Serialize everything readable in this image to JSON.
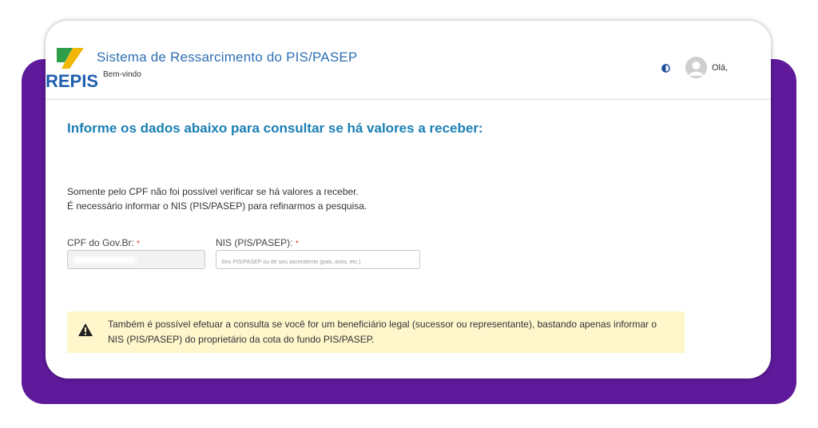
{
  "header": {
    "logo_text": "REPIS",
    "title": "Sistema de Ressarcimento do PIS/PASEP",
    "welcome": "Bem-vindo",
    "contrast_icon": "contrast-icon",
    "avatar_icon": "user-avatar-icon",
    "greeting": "Olá,"
  },
  "main": {
    "heading": "Informe os dados abaixo para consultar se há valores a receber:",
    "message_line1": "Somente pelo CPF não foi possível verificar se há valores a receber.",
    "message_line2": "É necessário informar o NIS (PIS/PASEP) para refinarmos a pesquisa.",
    "cpf": {
      "label": "CPF do Gov.Br:",
      "required_mark": "*",
      "value": ""
    },
    "nis": {
      "label": "NIS (PIS/PASEP):",
      "required_mark": "*",
      "placeholder": "Seu PIS/PASEP ou de seu ascendente (pais, avós, etc.)"
    },
    "alert": {
      "icon": "warning-icon",
      "text": "Também é possível efetuar a consulta se você for um beneficiário legal (sucessor ou representante), bastando apenas informar o NIS (PIS/PASEP) do proprietário da cota do fundo PIS/PASEP."
    }
  },
  "colors": {
    "brand_purple": "#5e1a9b",
    "title_blue": "#2f6fb3",
    "heading_blue": "#1a7fb5",
    "alert_bg": "#fff6cc",
    "required_red": "#dd3333"
  }
}
